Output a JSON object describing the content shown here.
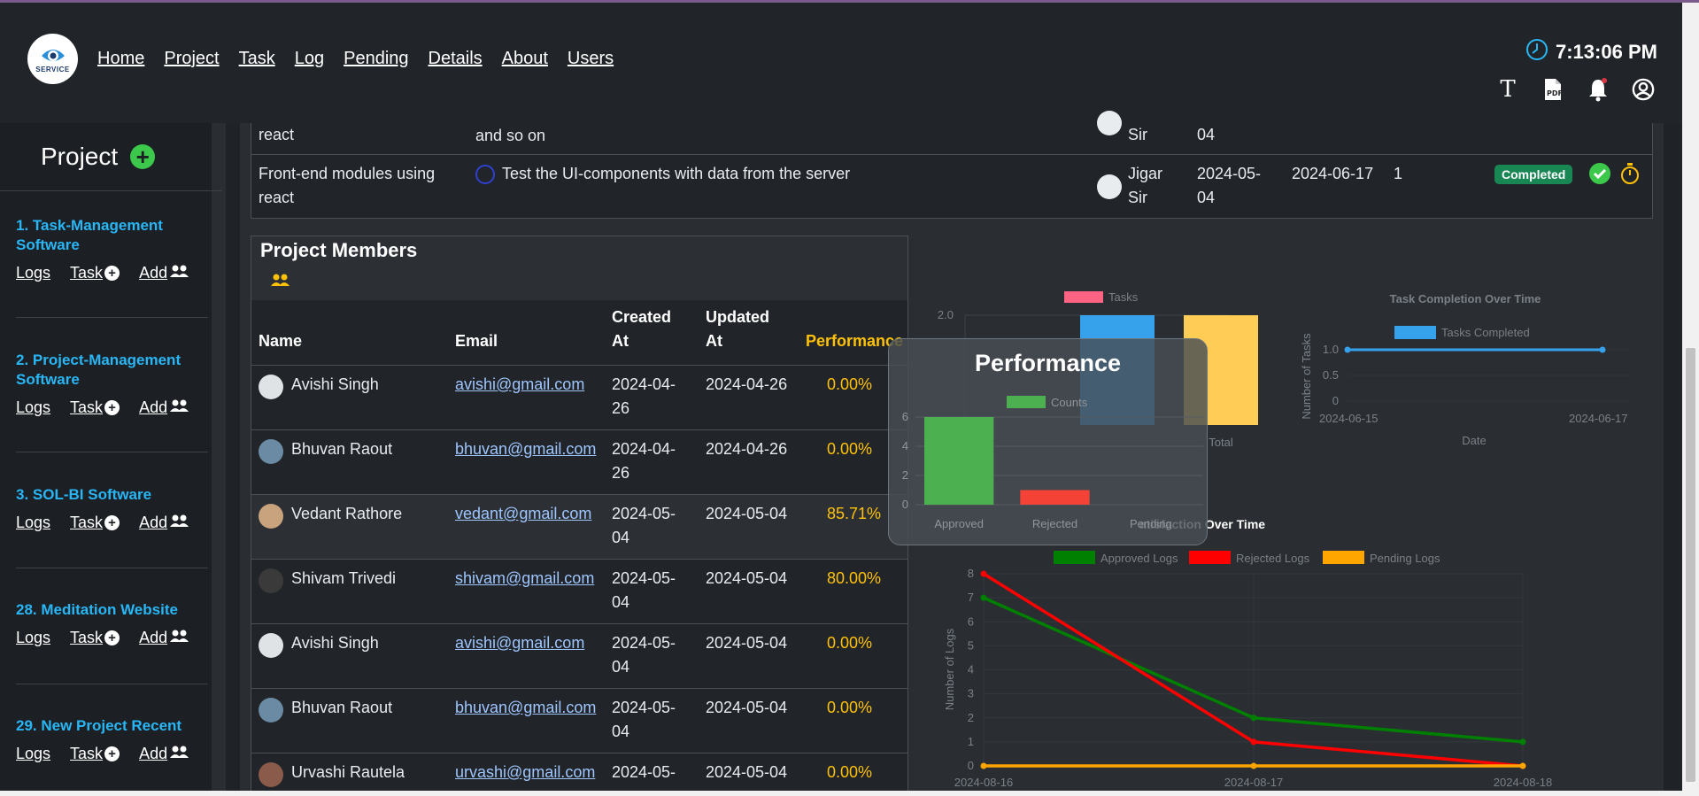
{
  "nav": {
    "logo_text": "SERVICE",
    "links": [
      "Home",
      "Project",
      "Task",
      "Log",
      "Pending",
      "Details",
      "About",
      "Users"
    ],
    "time": "7:13:06 PM",
    "icons": [
      "text-icon",
      "pdf-icon",
      "bell-icon",
      "user-circle-icon"
    ]
  },
  "sidebar": {
    "title": "Project",
    "projects": [
      {
        "name": "1. Task-Management Software",
        "logs": "Logs",
        "task": "Task",
        "add": "Add"
      },
      {
        "name": "2. Project-Management Software",
        "logs": "Logs",
        "task": "Task",
        "add": "Add"
      },
      {
        "name": "3. SOL-BI Software",
        "logs": "Logs",
        "task": "Task",
        "add": "Add"
      },
      {
        "name": "28. Meditation Website",
        "logs": "Logs",
        "task": "Task",
        "add": "Add"
      },
      {
        "name": "29. New Project Recent",
        "logs": "Logs",
        "task": "Task",
        "add": "Add"
      }
    ]
  },
  "tasks": {
    "rows": [
      {
        "module": "react",
        "desc": "and so on",
        "assignee": "Sir",
        "start": "04",
        "end": "",
        "count": "",
        "status": ""
      },
      {
        "module1": "Front-end modules using",
        "module2": "react",
        "desc": "Test the UI-components with data from the server",
        "assignee1": "Jigar",
        "assignee2": "Sir",
        "start1": "2024-05-",
        "start2": "04",
        "end": "2024-06-17",
        "count": "1",
        "status": "Completed"
      }
    ]
  },
  "members": {
    "title": "Project Members",
    "headers": {
      "name": "Name",
      "email": "Email",
      "created1": "Created",
      "created2": "At",
      "updated1": "Updated",
      "updated2": "At",
      "performance": "Performance"
    },
    "rows": [
      {
        "name": "Avishi Singh",
        "email": "avishi@gmail.com",
        "created1": "2024-04-",
        "created2": "26",
        "updated": "2024-04-26",
        "perf": "0.00%"
      },
      {
        "name": "Bhuvan Raout",
        "email": "bhuvan@gmail.com",
        "created1": "2024-04-",
        "created2": "26",
        "updated": "2024-04-26",
        "perf": "0.00%"
      },
      {
        "name": "Vedant Rathore",
        "email": "vedant@gmail.com",
        "created1": "2024-05-",
        "created2": "04",
        "updated": "2024-05-04",
        "perf": "85.71%"
      },
      {
        "name": "Shivam Trivedi",
        "email": "shivam@gmail.com",
        "created1": "2024-05-",
        "created2": "04",
        "updated": "2024-05-04",
        "perf": "80.00%"
      },
      {
        "name": "Avishi Singh",
        "email": "avishi@gmail.com",
        "created1": "2024-05-",
        "created2": "04",
        "updated": "2024-05-04",
        "perf": "0.00%"
      },
      {
        "name": "Bhuvan Raout",
        "email": "bhuvan@gmail.com",
        "created1": "2024-05-",
        "created2": "04",
        "updated": "2024-05-04",
        "perf": "0.00%"
      },
      {
        "name": "Urvashi Rautela",
        "email": "urvashi@gmail.com",
        "created1": "2024-05-",
        "created2": "",
        "updated": "2024-05-04",
        "perf": "0.00%"
      }
    ]
  },
  "chart_data": [
    {
      "type": "bar",
      "legend": [
        "Tasks"
      ],
      "categories": [
        "",
        "Total"
      ],
      "ylim": [
        0,
        2.0
      ],
      "yticks": [
        "2.0"
      ],
      "series": [
        {
          "name": "Tasks",
          "values": [
            2,
            2
          ]
        }
      ],
      "colors": [
        "#ff6384",
        "#36a2eb",
        "#ffcd56"
      ]
    },
    {
      "type": "line",
      "title": "Task Completion Over Time",
      "legend": [
        "Tasks Completed"
      ],
      "x": [
        "2024-06-15",
        "2024-06-17"
      ],
      "xlabel": "Date",
      "ylabel": "Number of Tasks",
      "ylim": [
        0,
        1.0
      ],
      "yticks": [
        "1.0",
        "0.5",
        "0"
      ],
      "series": [
        {
          "name": "Tasks Completed",
          "values": [
            1,
            1
          ]
        }
      ],
      "color": "#36a2eb"
    },
    {
      "type": "bar",
      "title": "Performance",
      "legend": [
        "Counts"
      ],
      "categories": [
        "Approved",
        "Rejected",
        "Pending"
      ],
      "values": [
        6,
        1,
        0
      ],
      "ylim": [
        0,
        6
      ],
      "yticks": [
        "6",
        "4",
        "2",
        "0"
      ],
      "colors": [
        "#4caf50",
        "#f44336",
        "#ffc107"
      ]
    },
    {
      "type": "line",
      "title": "Satisfaction Over Time",
      "title_visible": "atisfaction Over Time",
      "legend": [
        "Approved Logs",
        "Rejected Logs",
        "Pending Logs"
      ],
      "x": [
        "2024-08-16",
        "2024-08-17",
        "2024-08-18"
      ],
      "ylabel": "Number of Logs",
      "ylim": [
        0,
        8
      ],
      "yticks": [
        "8",
        "7",
        "6",
        "5",
        "4",
        "3",
        "2",
        "1",
        "0"
      ],
      "series": [
        {
          "name": "Approved Logs",
          "values": [
            7,
            2,
            1
          ],
          "color": "#008000"
        },
        {
          "name": "Rejected Logs",
          "values": [
            8,
            1,
            0
          ],
          "color": "#ff0000"
        },
        {
          "name": "Pending Logs",
          "values": [
            0,
            0,
            0
          ],
          "color": "#ffa500"
        }
      ]
    }
  ]
}
